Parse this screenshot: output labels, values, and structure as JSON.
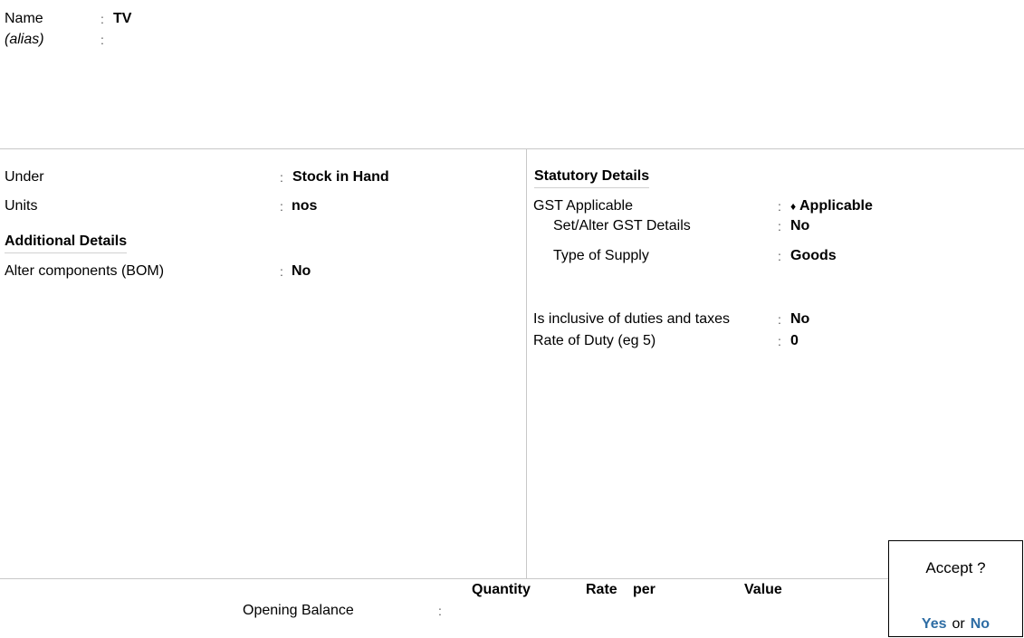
{
  "header": {
    "name_label": "Name",
    "name_value": "TV",
    "alias_label": "(alias)",
    "alias_value": "",
    "colon": ":"
  },
  "left": {
    "under_label": "Under",
    "under_value": "Stock in Hand",
    "units_label": "Units",
    "units_value": "nos",
    "additional_heading": "Additional Details",
    "bom_label": "Alter components (BOM)",
    "bom_value": "No"
  },
  "right": {
    "statutory_heading": "Statutory Details",
    "gst_applicable_label": "GST Applicable",
    "gst_applicable_marker": "♦",
    "gst_applicable_value": "Applicable",
    "set_alter_gst_label": "Set/Alter GST Details",
    "set_alter_gst_value": "No",
    "type_of_supply_label": "Type of Supply",
    "type_of_supply_value": "Goods",
    "inclusive_label": "Is inclusive of duties and taxes",
    "inclusive_value": "No",
    "rate_of_duty_label": "Rate of Duty (eg 5)",
    "rate_of_duty_value": "0"
  },
  "opening": {
    "columns": [
      "Quantity",
      "Rate",
      "per",
      "Value"
    ],
    "label": "Opening Balance",
    "colon": ":"
  },
  "accept_dialog": {
    "title": "Accept ?",
    "yes": "Yes",
    "or": "or",
    "no": "No"
  }
}
